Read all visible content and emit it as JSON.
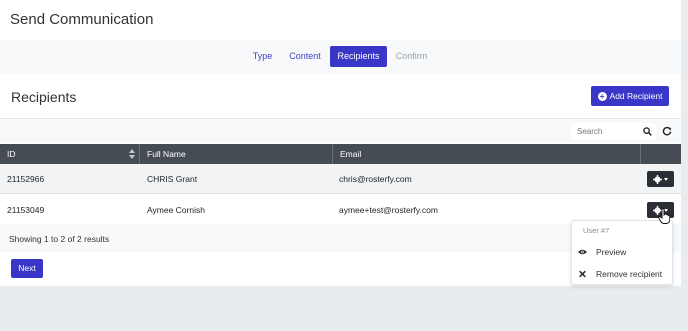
{
  "page": {
    "title": "Send Communication"
  },
  "stepper": {
    "steps": [
      {
        "label": "Type",
        "state": "link"
      },
      {
        "label": "Content",
        "state": "link"
      },
      {
        "label": "Recipients",
        "state": "active"
      },
      {
        "label": "Confirm",
        "state": "disabled"
      }
    ]
  },
  "recipients": {
    "title": "Recipients",
    "add_button": "Add Recipient",
    "search_placeholder": "Search",
    "columns": [
      "ID",
      "Full Name",
      "Email"
    ],
    "rows": [
      {
        "id": "21152966",
        "name": "CHRIS Grant",
        "email": "chris@rosterfy.com"
      },
      {
        "id": "21153049",
        "name": "Aymee Cornish",
        "email": "aymee+test@rosterfy.com"
      }
    ],
    "summary": "Showing 1 to 2 of 2 results",
    "next_button": "Next"
  },
  "row_menu": {
    "header": "User #7",
    "items": [
      {
        "label": "Preview",
        "icon": "eye-icon"
      },
      {
        "label": "Remove recipient",
        "icon": "close-icon"
      }
    ]
  },
  "colors": {
    "primary": "#3a37c8",
    "header_dark": "#464c54",
    "gear_button": "#2b2f35"
  }
}
